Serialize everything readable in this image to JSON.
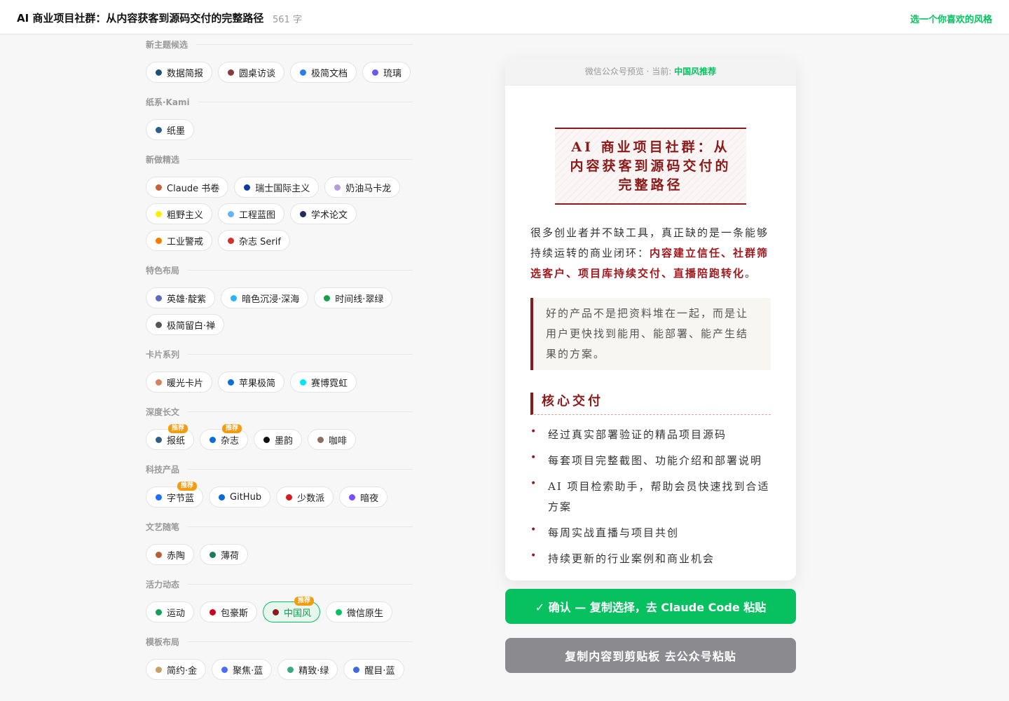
{
  "header": {
    "title": "AI 商业项目社群：从内容获客到源码交付的完整路径",
    "word_count": "561 字",
    "hint": "选一个你喜欢的风格"
  },
  "groups": [
    {
      "title": "新主题候选",
      "items": [
        {
          "label": "数据简报",
          "color": "#1f4e79"
        },
        {
          "label": "圆桌访谈",
          "color": "#8b3a3a"
        },
        {
          "label": "极简文档",
          "color": "#2b7de9"
        },
        {
          "label": "琉璃",
          "color": "#6b5ce7"
        }
      ]
    },
    {
      "title": "纸系·Kami",
      "items": [
        {
          "label": "纸墨",
          "color": "#2f5d8a"
        }
      ]
    },
    {
      "title": "新做精选",
      "items": [
        {
          "label": "Claude 书卷",
          "color": "#c7613d"
        },
        {
          "label": "瑞士国际主义",
          "color": "#0d3b99"
        },
        {
          "label": "奶油马卡龙",
          "color": "#b39ddb"
        },
        {
          "label": "粗野主义",
          "color": "#ffee00"
        },
        {
          "label": "工程蓝图",
          "color": "#64b5f6"
        },
        {
          "label": "学术论文",
          "color": "#1c2e5a"
        },
        {
          "label": "工业警戒",
          "color": "#f57c00"
        },
        {
          "label": "杂志 Serif",
          "color": "#d32f2f"
        }
      ]
    },
    {
      "title": "特色布局",
      "items": [
        {
          "label": "英雄·靛紫",
          "color": "#5c6bc0"
        },
        {
          "label": "暗色沉浸·深海",
          "color": "#29b6f6"
        },
        {
          "label": "时间线·翠绿",
          "color": "#1b9e4b"
        },
        {
          "label": "极简留白·禅",
          "color": "#555555"
        }
      ]
    },
    {
      "title": "卡片系列",
      "items": [
        {
          "label": "暖光卡片",
          "color": "#d9805f"
        },
        {
          "label": "苹果极简",
          "color": "#0a6fd8"
        },
        {
          "label": "赛博霓虹",
          "color": "#00e5ff"
        }
      ]
    },
    {
      "title": "深度长文",
      "items": [
        {
          "label": "报纸",
          "color": "#2f5d8a",
          "badge": "推荐"
        },
        {
          "label": "杂志",
          "color": "#0a6fd8",
          "badge": "推荐"
        },
        {
          "label": "墨韵",
          "color": "#111111"
        },
        {
          "label": "咖啡",
          "color": "#8d6e63"
        }
      ]
    },
    {
      "title": "科技产品",
      "items": [
        {
          "label": "字节蓝",
          "color": "#1e6fff",
          "badge": "推荐"
        },
        {
          "label": "GitHub",
          "color": "#0969da"
        },
        {
          "label": "少数派",
          "color": "#d71a1b"
        },
        {
          "label": "暗夜",
          "color": "#7c4dff"
        }
      ]
    },
    {
      "title": "文艺随笔",
      "items": [
        {
          "label": "赤陶",
          "color": "#b85c38"
        },
        {
          "label": "薄荷",
          "color": "#1b7a5a"
        }
      ]
    },
    {
      "title": "活力动态",
      "items": [
        {
          "label": "运动",
          "color": "#14a05a"
        },
        {
          "label": "包豪斯",
          "color": "#d0021b"
        },
        {
          "label": "中国风",
          "color": "#8b1a1a",
          "badge": "推荐",
          "active": true
        },
        {
          "label": "微信原生",
          "color": "#07c160"
        }
      ]
    },
    {
      "title": "模板布局",
      "items": [
        {
          "label": "简约·金",
          "color": "#c9a063"
        },
        {
          "label": "聚焦·蓝",
          "color": "#4a6cf7"
        },
        {
          "label": "精致·绿",
          "color": "#3aaa7e"
        },
        {
          "label": "醒目·蓝",
          "color": "#4169e1"
        }
      ]
    }
  ],
  "preview": {
    "label": "微信公众号预览 · 当前: ",
    "current": "中国风推荐",
    "title": "AI 商业项目社群：从内容获客到源码交付的完整路径",
    "para_lead": "很多创业者并不缺工具，真正缺的是一条能够持续运转的商业闭环：",
    "para_highlight": "内容建立信任、社群筛选客户、项目库持续交付、直播陪跑转化",
    "para_end": "。",
    "quote": "好的产品不是把资料堆在一起，而是让用户更快找到能用、能部署、能产生结果的方案。",
    "section_title": "核心交付",
    "list": [
      "经过真实部署验证的精品项目源码",
      "每套项目完整截图、功能介绍和部署说明",
      "AI 项目检索助手，帮助会员快速找到合适方案",
      "每周实战直播与项目共创",
      "持续更新的行业案例和商业机会"
    ]
  },
  "buttons": {
    "confirm": "✓ 确认 — 复制选择，去 Claude Code 粘贴",
    "copy": "复制内容到剪贴板 去公众号粘贴"
  }
}
